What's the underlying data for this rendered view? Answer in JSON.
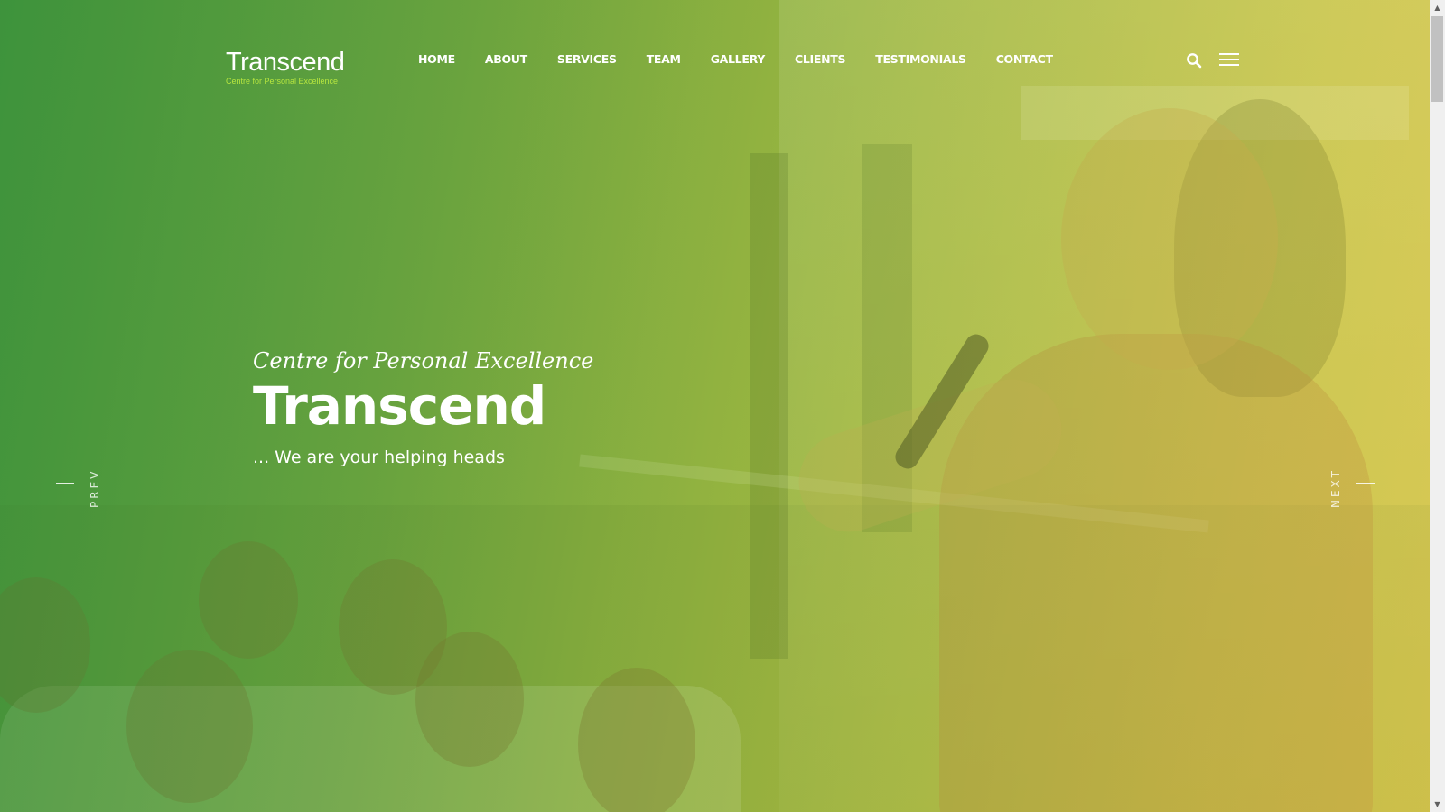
{
  "logo": {
    "title": "Transcend",
    "subtitle": "Centre for Personal Excellence"
  },
  "nav": {
    "items": [
      {
        "label": "HOME"
      },
      {
        "label": "ABOUT"
      },
      {
        "label": "SERVICES"
      },
      {
        "label": "TEAM"
      },
      {
        "label": "GALLERY"
      },
      {
        "label": "CLIENTS"
      },
      {
        "label": "TESTIMONIALS"
      },
      {
        "label": "CONTACT"
      }
    ]
  },
  "header_icons": {
    "search": "search-icon",
    "menu": "hamburger-menu-icon"
  },
  "hero": {
    "subtitle": "Centre for Personal Excellence",
    "title": "Transcend",
    "tagline": "... We are your helping heads"
  },
  "slider": {
    "prev_label": "PREV",
    "next_label": "NEXT"
  },
  "colors": {
    "overlay_start": "#3f8f3c",
    "overlay_end": "#d8c24a",
    "logo_accent": "#b7e63f",
    "text": "#ffffff"
  }
}
